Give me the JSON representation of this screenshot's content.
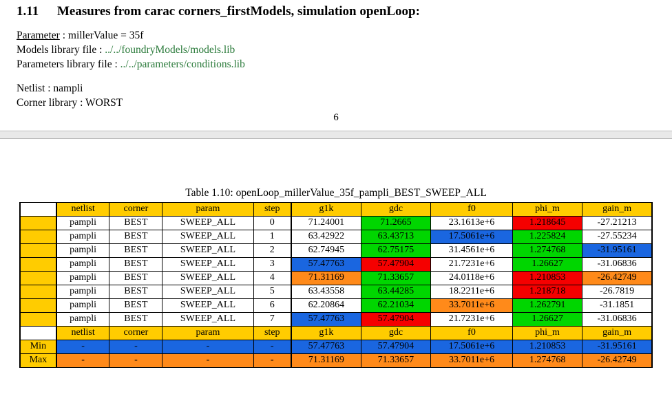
{
  "section": {
    "number": "1.11",
    "title": "Measures from carac corners_firstModels, simulation openLoop:"
  },
  "meta": {
    "param_label": "Parameter",
    "param_expr": "millerValue = 35f",
    "models_label": "Models library file : ",
    "models_link": "../../foundryModels/models.lib",
    "params_label": "Parameters library file : ",
    "params_link": "../../parameters/conditions.lib",
    "netlist_label": "Netlist : nampli",
    "corner_label": "Corner library : WORST",
    "page_number": "6"
  },
  "table_caption": "Table 1.10: openLoop_millerValue_35f_pampli_BEST_SWEEP_ALL",
  "headers": [
    "netlist",
    "corner",
    "param",
    "step",
    "g1k",
    "gdc",
    "f0",
    "phi_m",
    "gain_m"
  ],
  "rows": [
    {
      "netlist": "pampli",
      "corner": "BEST",
      "param": "SWEEP_ALL",
      "step": "0",
      "g1k": {
        "v": "71.24001"
      },
      "gdc": {
        "v": "71.2665",
        "c": "green"
      },
      "f0": {
        "v": "23.1613e+6"
      },
      "phi_m": {
        "v": "1.218645",
        "c": "red"
      },
      "gain_m": {
        "v": "-27.21213"
      }
    },
    {
      "netlist": "pampli",
      "corner": "BEST",
      "param": "SWEEP_ALL",
      "step": "1",
      "g1k": {
        "v": "63.42922"
      },
      "gdc": {
        "v": "63.43713",
        "c": "green"
      },
      "f0": {
        "v": "17.5061e+6",
        "c": "blue"
      },
      "phi_m": {
        "v": "1.225824",
        "c": "green"
      },
      "gain_m": {
        "v": "-27.55234"
      }
    },
    {
      "netlist": "pampli",
      "corner": "BEST",
      "param": "SWEEP_ALL",
      "step": "2",
      "g1k": {
        "v": "62.74945"
      },
      "gdc": {
        "v": "62.75175",
        "c": "green"
      },
      "f0": {
        "v": "31.4561e+6"
      },
      "phi_m": {
        "v": "1.274768",
        "c": "green"
      },
      "gain_m": {
        "v": "-31.95161",
        "c": "blue"
      }
    },
    {
      "netlist": "pampli",
      "corner": "BEST",
      "param": "SWEEP_ALL",
      "step": "3",
      "g1k": {
        "v": "57.47763",
        "c": "blue"
      },
      "gdc": {
        "v": "57.47904",
        "c": "red"
      },
      "f0": {
        "v": "21.7231e+6"
      },
      "phi_m": {
        "v": "1.26627",
        "c": "green"
      },
      "gain_m": {
        "v": "-31.06836"
      }
    },
    {
      "netlist": "pampli",
      "corner": "BEST",
      "param": "SWEEP_ALL",
      "step": "4",
      "g1k": {
        "v": "71.31169",
        "c": "orange"
      },
      "gdc": {
        "v": "71.33657",
        "c": "green"
      },
      "f0": {
        "v": "24.0118e+6"
      },
      "phi_m": {
        "v": "1.210853",
        "c": "red"
      },
      "gain_m": {
        "v": "-26.42749",
        "c": "orange"
      }
    },
    {
      "netlist": "pampli",
      "corner": "BEST",
      "param": "SWEEP_ALL",
      "step": "5",
      "g1k": {
        "v": "63.43558"
      },
      "gdc": {
        "v": "63.44285",
        "c": "green"
      },
      "f0": {
        "v": "18.2211e+6"
      },
      "phi_m": {
        "v": "1.218718",
        "c": "red"
      },
      "gain_m": {
        "v": "-26.7819"
      }
    },
    {
      "netlist": "pampli",
      "corner": "BEST",
      "param": "SWEEP_ALL",
      "step": "6",
      "g1k": {
        "v": "62.20864"
      },
      "gdc": {
        "v": "62.21034",
        "c": "green"
      },
      "f0": {
        "v": "33.7011e+6",
        "c": "orange"
      },
      "phi_m": {
        "v": "1.262791",
        "c": "green"
      },
      "gain_m": {
        "v": "-31.1851"
      }
    },
    {
      "netlist": "pampli",
      "corner": "BEST",
      "param": "SWEEP_ALL",
      "step": "7",
      "g1k": {
        "v": "57.47763",
        "c": "blue"
      },
      "gdc": {
        "v": "57.47904",
        "c": "red"
      },
      "f0": {
        "v": "21.7231e+6"
      },
      "phi_m": {
        "v": "1.26627",
        "c": "green"
      },
      "gain_m": {
        "v": "-31.06836"
      }
    }
  ],
  "summary": {
    "min_label": "Min",
    "max_label": "Max",
    "dash": "-",
    "min": {
      "g1k": "57.47763",
      "gdc": "57.47904",
      "f0": "17.5061e+6",
      "phi_m": "1.210853",
      "gain_m": "-31.95161"
    },
    "max": {
      "g1k": "71.31169",
      "gdc": "71.33657",
      "f0": "33.7011e+6",
      "phi_m": "1.274768",
      "gain_m": "-26.42749"
    }
  },
  "chart_data": {
    "type": "table",
    "title": "openLoop_millerValue_35f_pampli_BEST_SWEEP_ALL",
    "columns": [
      "netlist",
      "corner",
      "param",
      "step",
      "g1k",
      "gdc",
      "f0",
      "phi_m",
      "gain_m"
    ],
    "rows": [
      [
        "pampli",
        "BEST",
        "SWEEP_ALL",
        0,
        71.24001,
        71.2665,
        23161300,
        1.218645,
        -27.21213
      ],
      [
        "pampli",
        "BEST",
        "SWEEP_ALL",
        1,
        63.42922,
        63.43713,
        17506100,
        1.225824,
        -27.55234
      ],
      [
        "pampli",
        "BEST",
        "SWEEP_ALL",
        2,
        62.74945,
        62.75175,
        31456100,
        1.274768,
        -31.95161
      ],
      [
        "pampli",
        "BEST",
        "SWEEP_ALL",
        3,
        57.47763,
        57.47904,
        21723100,
        1.26627,
        -31.06836
      ],
      [
        "pampli",
        "BEST",
        "SWEEP_ALL",
        4,
        71.31169,
        71.33657,
        24011800,
        1.210853,
        -26.42749
      ],
      [
        "pampli",
        "BEST",
        "SWEEP_ALL",
        5,
        63.43558,
        63.44285,
        18221100,
        1.218718,
        -26.7819
      ],
      [
        "pampli",
        "BEST",
        "SWEEP_ALL",
        6,
        62.20864,
        62.21034,
        33701100,
        1.262791,
        -31.1851
      ],
      [
        "pampli",
        "BEST",
        "SWEEP_ALL",
        7,
        57.47763,
        57.47904,
        21723100,
        1.26627,
        -31.06836
      ]
    ],
    "min": {
      "g1k": 57.47763,
      "gdc": 57.47904,
      "f0": 17506100,
      "phi_m": 1.210853,
      "gain_m": -31.95161
    },
    "max": {
      "g1k": 71.31169,
      "gdc": 71.33657,
      "f0": 33701100,
      "phi_m": 1.274768,
      "gain_m": -26.42749
    }
  }
}
